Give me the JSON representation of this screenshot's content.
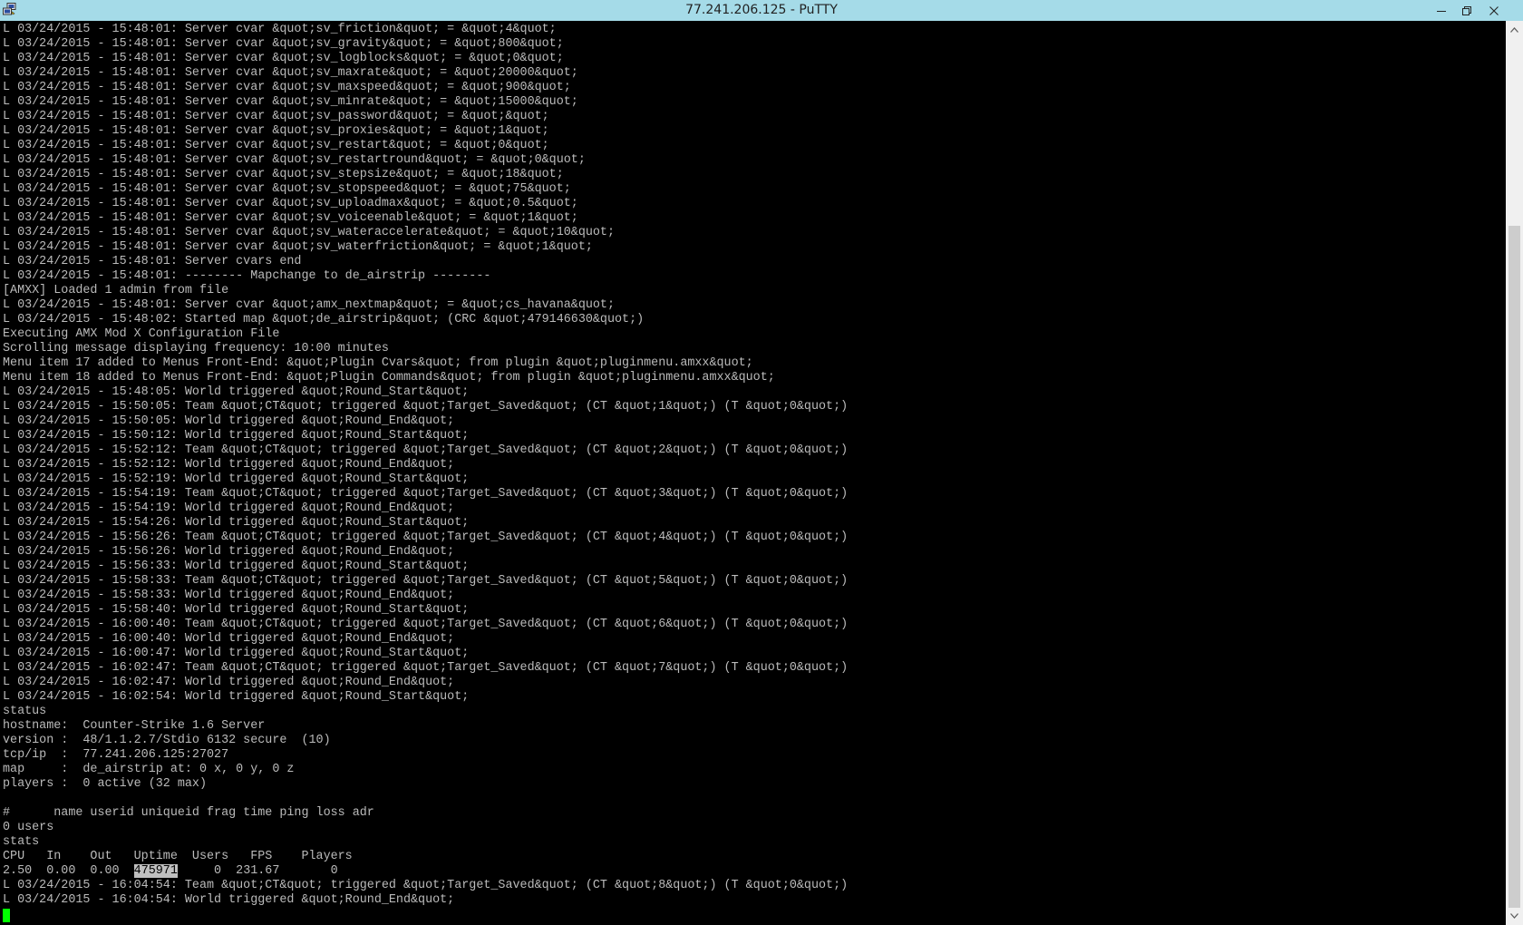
{
  "window": {
    "title": "77.241.206.125 - PuTTY",
    "app_icon": "putty-icon",
    "controls": [
      "minimize-icon",
      "restore-icon",
      "close-icon"
    ]
  },
  "terminal": {
    "lines": [
      "L 03/24/2015 - 15:48:01: Server cvar &quot;sv_friction&quot; = &quot;4&quot;",
      "L 03/24/2015 - 15:48:01: Server cvar &quot;sv_gravity&quot; = &quot;800&quot;",
      "L 03/24/2015 - 15:48:01: Server cvar &quot;sv_logblocks&quot; = &quot;0&quot;",
      "L 03/24/2015 - 15:48:01: Server cvar &quot;sv_maxrate&quot; = &quot;20000&quot;",
      "L 03/24/2015 - 15:48:01: Server cvar &quot;sv_maxspeed&quot; = &quot;900&quot;",
      "L 03/24/2015 - 15:48:01: Server cvar &quot;sv_minrate&quot; = &quot;15000&quot;",
      "L 03/24/2015 - 15:48:01: Server cvar &quot;sv_password&quot; = &quot;&quot;",
      "L 03/24/2015 - 15:48:01: Server cvar &quot;sv_proxies&quot; = &quot;1&quot;",
      "L 03/24/2015 - 15:48:01: Server cvar &quot;sv_restart&quot; = &quot;0&quot;",
      "L 03/24/2015 - 15:48:01: Server cvar &quot;sv_restartround&quot; = &quot;0&quot;",
      "L 03/24/2015 - 15:48:01: Server cvar &quot;sv_stepsize&quot; = &quot;18&quot;",
      "L 03/24/2015 - 15:48:01: Server cvar &quot;sv_stopspeed&quot; = &quot;75&quot;",
      "L 03/24/2015 - 15:48:01: Server cvar &quot;sv_uploadmax&quot; = &quot;0.5&quot;",
      "L 03/24/2015 - 15:48:01: Server cvar &quot;sv_voiceenable&quot; = &quot;1&quot;",
      "L 03/24/2015 - 15:48:01: Server cvar &quot;sv_wateraccelerate&quot; = &quot;10&quot;",
      "L 03/24/2015 - 15:48:01: Server cvar &quot;sv_waterfriction&quot; = &quot;1&quot;",
      "L 03/24/2015 - 15:48:01: Server cvars end",
      "L 03/24/2015 - 15:48:01: -------- Mapchange to de_airstrip --------",
      "[AMXX] Loaded 1 admin from file",
      "L 03/24/2015 - 15:48:01: Server cvar &quot;amx_nextmap&quot; = &quot;cs_havana&quot;",
      "L 03/24/2015 - 15:48:02: Started map &quot;de_airstrip&quot; (CRC &quot;479146630&quot;)",
      "Executing AMX Mod X Configuration File",
      "Scrolling message displaying frequency: 10:00 minutes",
      "Menu item 17 added to Menus Front-End: &quot;Plugin Cvars&quot; from plugin &quot;pluginmenu.amxx&quot;",
      "Menu item 18 added to Menus Front-End: &quot;Plugin Commands&quot; from plugin &quot;pluginmenu.amxx&quot;",
      "L 03/24/2015 - 15:48:05: World triggered &quot;Round_Start&quot;",
      "L 03/24/2015 - 15:50:05: Team &quot;CT&quot; triggered &quot;Target_Saved&quot; (CT &quot;1&quot;) (T &quot;0&quot;)",
      "L 03/24/2015 - 15:50:05: World triggered &quot;Round_End&quot;",
      "L 03/24/2015 - 15:50:12: World triggered &quot;Round_Start&quot;",
      "L 03/24/2015 - 15:52:12: Team &quot;CT&quot; triggered &quot;Target_Saved&quot; (CT &quot;2&quot;) (T &quot;0&quot;)",
      "L 03/24/2015 - 15:52:12: World triggered &quot;Round_End&quot;",
      "L 03/24/2015 - 15:52:19: World triggered &quot;Round_Start&quot;",
      "L 03/24/2015 - 15:54:19: Team &quot;CT&quot; triggered &quot;Target_Saved&quot; (CT &quot;3&quot;) (T &quot;0&quot;)",
      "L 03/24/2015 - 15:54:19: World triggered &quot;Round_End&quot;",
      "L 03/24/2015 - 15:54:26: World triggered &quot;Round_Start&quot;",
      "L 03/24/2015 - 15:56:26: Team &quot;CT&quot; triggered &quot;Target_Saved&quot; (CT &quot;4&quot;) (T &quot;0&quot;)",
      "L 03/24/2015 - 15:56:26: World triggered &quot;Round_End&quot;",
      "L 03/24/2015 - 15:56:33: World triggered &quot;Round_Start&quot;",
      "L 03/24/2015 - 15:58:33: Team &quot;CT&quot; triggered &quot;Target_Saved&quot; (CT &quot;5&quot;) (T &quot;0&quot;)",
      "L 03/24/2015 - 15:58:33: World triggered &quot;Round_End&quot;",
      "L 03/24/2015 - 15:58:40: World triggered &quot;Round_Start&quot;",
      "L 03/24/2015 - 16:00:40: Team &quot;CT&quot; triggered &quot;Target_Saved&quot; (CT &quot;6&quot;) (T &quot;0&quot;)",
      "L 03/24/2015 - 16:00:40: World triggered &quot;Round_End&quot;",
      "L 03/24/2015 - 16:00:47: World triggered &quot;Round_Start&quot;",
      "L 03/24/2015 - 16:02:47: Team &quot;CT&quot; triggered &quot;Target_Saved&quot; (CT &quot;7&quot;) (T &quot;0&quot;)",
      "L 03/24/2015 - 16:02:47: World triggered &quot;Round_End&quot;",
      "L 03/24/2015 - 16:02:54: World triggered &quot;Round_Start&quot;",
      "status",
      "hostname:  Counter-Strike 1.6 Server",
      "version :  48/1.1.2.7/Stdio 6132 secure  (10)",
      "tcp/ip  :  77.241.206.125:27027",
      "map     :  de_airstrip at: 0 x, 0 y, 0 z",
      "players :  0 active (32 max)",
      "",
      "#      name userid uniqueid frag time ping loss adr",
      "0 users",
      "stats"
    ],
    "stats_header": "CPU   In    Out   Uptime  Users   FPS    Players",
    "stats_row": {
      "prefix": "2.50  0.00  0.00  ",
      "uptime": "475971",
      "suffix": "     0  231.67       0"
    },
    "tail_lines": [
      "L 03/24/2015 - 16:04:54: Team &quot;CT&quot; triggered &quot;Target_Saved&quot; (CT &quot;8&quot;) (T &quot;0&quot;)",
      "L 03/24/2015 - 16:04:54: World triggered &quot;Round_End&quot;"
    ],
    "cursor_color": "#00ff00",
    "text_color": "#bbbbbb",
    "background_color": "#000000"
  },
  "scrollbar": {
    "up_icon": "scroll-up-arrow-icon",
    "down_icon": "scroll-down-arrow-icon"
  },
  "colors": {
    "titlebar": "#a5dbe8",
    "scrollbar_track": "#f0f0f0",
    "scrollbar_thumb": "#cdcdcd"
  }
}
